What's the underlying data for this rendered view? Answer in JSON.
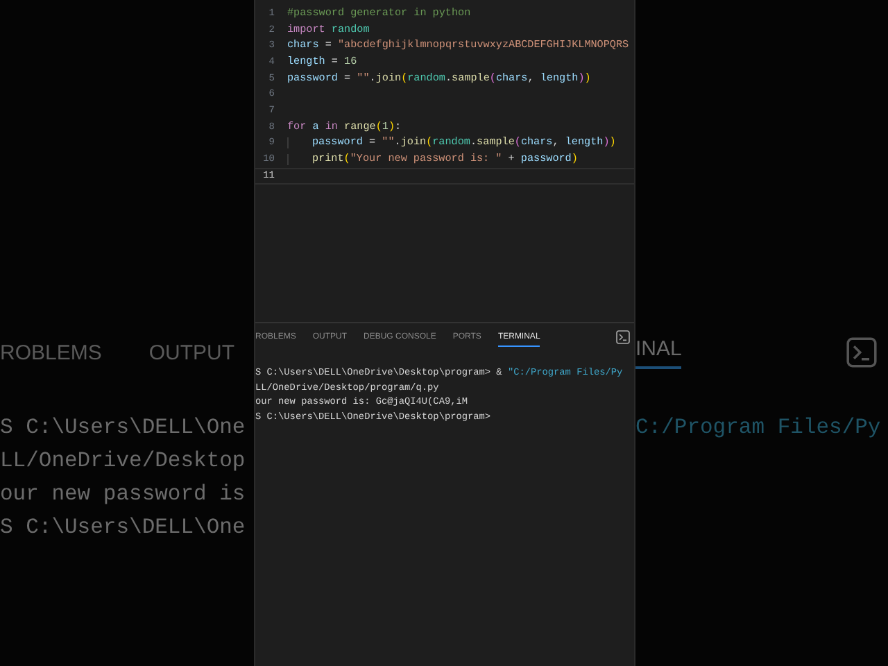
{
  "backdrop": {
    "left": {
      "tabs": [
        "ROBLEMS",
        "OUTPUT"
      ],
      "lines": [
        "S C:\\Users\\DELL\\One",
        "LL/OneDrive/Desktop",
        "our new password is",
        "S C:\\Users\\DELL\\One"
      ]
    },
    "right": {
      "tab": "INAL",
      "lines": [
        "C:/Program Files/Py"
      ]
    }
  },
  "editor": {
    "lines": [
      {
        "number": "1",
        "current": false,
        "tokens": [
          {
            "kind": "comment",
            "text": "#password generator in python"
          }
        ]
      },
      {
        "number": "2",
        "current": false,
        "tokens": [
          {
            "kind": "keyword",
            "text": "import "
          },
          {
            "kind": "module",
            "text": "random"
          }
        ]
      },
      {
        "number": "3",
        "current": false,
        "tokens": [
          {
            "kind": "var",
            "text": "chars"
          },
          {
            "kind": "plain",
            "text": " = "
          },
          {
            "kind": "string",
            "text": "\"abcdefghijklmnopqrstuvwxyzABCDEFGHIJKLMNOPQRS"
          }
        ]
      },
      {
        "number": "4",
        "current": false,
        "tokens": [
          {
            "kind": "var",
            "text": "length"
          },
          {
            "kind": "plain",
            "text": " = "
          },
          {
            "kind": "number",
            "text": "16"
          }
        ]
      },
      {
        "number": "5",
        "current": false,
        "tokens": [
          {
            "kind": "var",
            "text": "password"
          },
          {
            "kind": "plain",
            "text": " = "
          },
          {
            "kind": "string",
            "text": "\"\""
          },
          {
            "kind": "plain",
            "text": "."
          },
          {
            "kind": "function",
            "text": "join"
          },
          {
            "kind": "paren1",
            "text": "("
          },
          {
            "kind": "module",
            "text": "random"
          },
          {
            "kind": "plain",
            "text": "."
          },
          {
            "kind": "function",
            "text": "sample"
          },
          {
            "kind": "paren2",
            "text": "("
          },
          {
            "kind": "var",
            "text": "chars"
          },
          {
            "kind": "plain",
            "text": ", "
          },
          {
            "kind": "var",
            "text": "length"
          },
          {
            "kind": "paren2",
            "text": ")"
          },
          {
            "kind": "paren1",
            "text": ")"
          }
        ]
      },
      {
        "number": "6",
        "current": false
      },
      {
        "number": "7",
        "current": false
      },
      {
        "number": "8",
        "current": false,
        "tokens": [
          {
            "kind": "keyword",
            "text": "for "
          },
          {
            "kind": "var",
            "text": "a "
          },
          {
            "kind": "keyword",
            "text": "in "
          },
          {
            "kind": "function",
            "text": "range"
          },
          {
            "kind": "paren1",
            "text": "("
          },
          {
            "kind": "number",
            "text": "1"
          },
          {
            "kind": "paren1",
            "text": ")"
          },
          {
            "kind": "plain",
            "text": ":"
          }
        ]
      },
      {
        "number": "9",
        "current": false,
        "indented": true,
        "tokens": [
          {
            "kind": "var",
            "text": "password"
          },
          {
            "kind": "plain",
            "text": " = "
          },
          {
            "kind": "string",
            "text": "\"\""
          },
          {
            "kind": "plain",
            "text": "."
          },
          {
            "kind": "function",
            "text": "join"
          },
          {
            "kind": "paren1",
            "text": "("
          },
          {
            "kind": "module",
            "text": "random"
          },
          {
            "kind": "plain",
            "text": "."
          },
          {
            "kind": "function",
            "text": "sample"
          },
          {
            "kind": "paren2",
            "text": "("
          },
          {
            "kind": "var",
            "text": "chars"
          },
          {
            "kind": "plain",
            "text": ", "
          },
          {
            "kind": "var",
            "text": "length"
          },
          {
            "kind": "paren2",
            "text": ")"
          },
          {
            "kind": "paren1",
            "text": ")"
          }
        ]
      },
      {
        "number": "10",
        "current": false,
        "indented": true,
        "tokens": [
          {
            "kind": "function",
            "text": "print"
          },
          {
            "kind": "paren1",
            "text": "("
          },
          {
            "kind": "string",
            "text": "\"Your new password is: \""
          },
          {
            "kind": "plain",
            "text": " + "
          },
          {
            "kind": "var",
            "text": "password"
          },
          {
            "kind": "paren1",
            "text": ")"
          }
        ]
      },
      {
        "number": "11",
        "current": true
      }
    ]
  },
  "panel": {
    "tabs": [
      {
        "label": "ROBLEMS",
        "selected": false
      },
      {
        "label": "OUTPUT",
        "selected": false
      },
      {
        "label": "DEBUG CONSOLE",
        "selected": false
      },
      {
        "label": "PORTS",
        "selected": false
      },
      {
        "label": "TERMINAL",
        "selected": true
      }
    ],
    "terminal": {
      "lines": [
        [
          {
            "kind": "plain",
            "text": "S C:\\Users\\DELL\\OneDrive\\Desktop\\program> & "
          },
          {
            "kind": "path",
            "text": "\"C:/Program Files/Py"
          }
        ],
        [
          {
            "kind": "plain",
            "text": "LL/OneDrive/Desktop/program/q.py"
          }
        ],
        [
          {
            "kind": "plain",
            "text": "our new password is: Gc@jaQI4U(CA9,iM"
          }
        ],
        [
          {
            "kind": "plain",
            "text": "S C:\\Users\\DELL\\OneDrive\\Desktop\\program>"
          }
        ]
      ]
    }
  }
}
